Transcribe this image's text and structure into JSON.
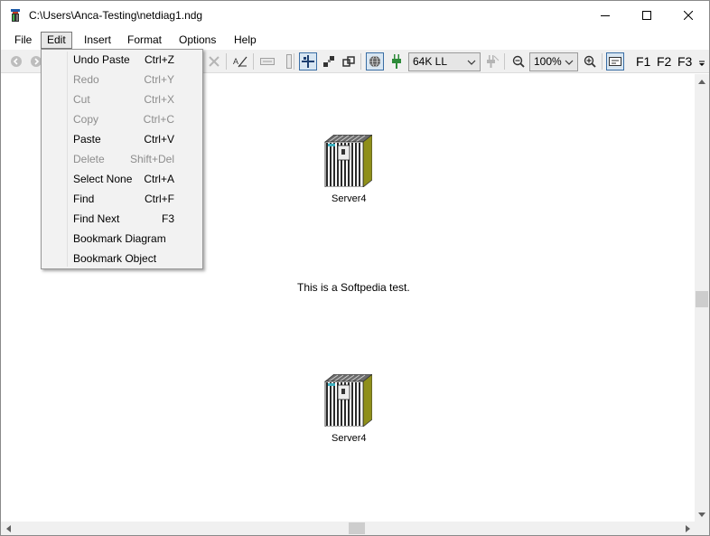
{
  "window": {
    "title": "C:\\Users\\Anca-Testing\\netdiag1.ndg"
  },
  "menubar": {
    "items": [
      {
        "label": "File"
      },
      {
        "label": "Edit"
      },
      {
        "label": "Insert"
      },
      {
        "label": "Format"
      },
      {
        "label": "Options"
      },
      {
        "label": "Help"
      }
    ]
  },
  "toolbar": {
    "speed_combo": "64K LL",
    "zoom_combo": "100%",
    "fkeys": [
      "F1",
      "F2",
      "F3"
    ]
  },
  "edit_menu": {
    "items": [
      {
        "label": "Undo Paste",
        "shortcut": "Ctrl+Z",
        "enabled": true
      },
      {
        "label": "Redo",
        "shortcut": "Ctrl+Y",
        "enabled": false
      },
      {
        "label": "Cut",
        "shortcut": "Ctrl+X",
        "enabled": false
      },
      {
        "label": "Copy",
        "shortcut": "Ctrl+C",
        "enabled": false
      },
      {
        "label": "Paste",
        "shortcut": "Ctrl+V",
        "enabled": true
      },
      {
        "label": "Delete",
        "shortcut": "Shift+Del",
        "enabled": false
      },
      {
        "label": "Select None",
        "shortcut": "Ctrl+A",
        "enabled": true
      },
      {
        "label": "Find",
        "shortcut": "Ctrl+F",
        "enabled": true
      },
      {
        "label": "Find Next",
        "shortcut": "F3",
        "enabled": true
      },
      {
        "label": "Bookmark Diagram",
        "shortcut": "",
        "enabled": true
      },
      {
        "label": "Bookmark Object",
        "shortcut": "",
        "enabled": true
      }
    ]
  },
  "canvas": {
    "servers": [
      {
        "label": "Server4"
      },
      {
        "label": "Server4"
      }
    ],
    "note": "This is a Softpedia test."
  },
  "colors": {
    "server_side": "#8f8f1a",
    "server_stripes": "#2a2a2a",
    "accent_pressed": "#3a6ea5"
  }
}
